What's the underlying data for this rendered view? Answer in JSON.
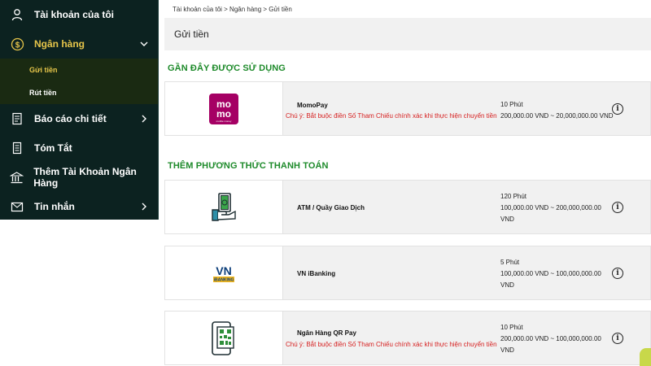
{
  "sidebar": {
    "items": [
      {
        "label": "Tài khoản của tôi",
        "icon": "user-icon"
      },
      {
        "label": "Ngân hàng",
        "icon": "dollar-icon"
      },
      {
        "label": "Báo cáo chi tiết",
        "icon": "report-icon"
      },
      {
        "label": "Tóm Tắt",
        "icon": "document-icon"
      },
      {
        "label": "Thêm Tài Khoản Ngân Hàng",
        "icon": "bank-icon"
      },
      {
        "label": "Tin nhắn",
        "icon": "mail-icon"
      }
    ],
    "sub_items": [
      {
        "label": "Gửi tiền"
      },
      {
        "label": "Rút tiền"
      }
    ],
    "accent_color": "#e6c54a"
  },
  "breadcrumb": "Tài khoản của tôi > Ngân hàng > Gửi tiền",
  "page_title": "Gửi tiền",
  "sections": {
    "recent": "GẦN ĐÂY ĐƯỢC SỬ DỤNG",
    "add": "THÊM PHƯƠNG THỨC THANH TOÁN"
  },
  "methods": [
    {
      "name": "MomoPay",
      "warning": "Chú ý: Bắt buộc điền Số Tham Chiếu chính xác khi thực hiện chuyển tiền",
      "time": "10 Phút",
      "range_line1": "200,000.00 VND ~ 20,000,000.00 VND",
      "range_line2": "",
      "logo_text": "mo mo",
      "logo_sub": "mobile money"
    },
    {
      "name": "ATM / Quầy Giao Dịch",
      "warning": "",
      "time": "120 Phút",
      "range_line1": "100,000.00 VND ~ 200,000,000.00",
      "range_line2": "VND"
    },
    {
      "name": "VN iBanking",
      "warning": "",
      "time": "5 Phút",
      "range_line1": "100,000.00 VND ~ 100,000,000.00",
      "range_line2": "VND",
      "logo_text": "VN",
      "logo_sub": "iBANKING"
    },
    {
      "name": "Ngân Hàng QR Pay",
      "warning": "Chú ý: Bắt buộc điền Số Tham Chiếu chính xác khi thực hiện chuyển tiền",
      "time": "10 Phút",
      "range_line1": "200,000.00 VND ~ 100,000,000.00",
      "range_line2": "VND"
    }
  ],
  "info_glyph": "i",
  "colors": {
    "sidebar_bg": "#0c2220",
    "section_green": "#1d8a2a",
    "warning_red": "#d62020",
    "momo_pink": "#a50064"
  }
}
